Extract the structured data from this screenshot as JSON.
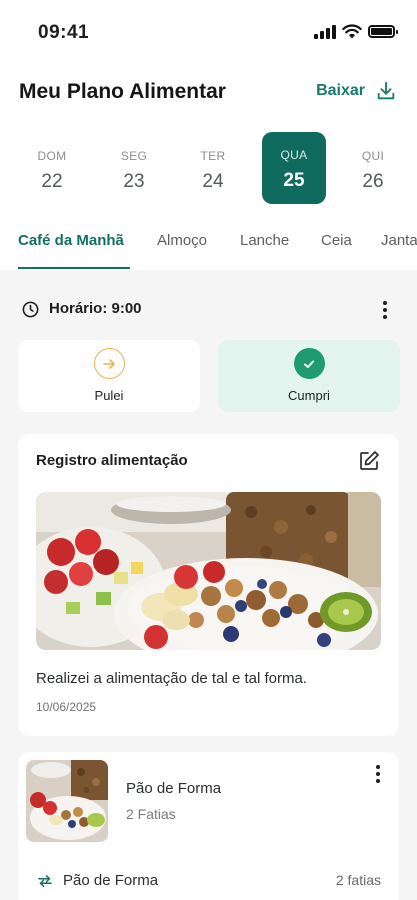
{
  "status_bar": {
    "time": "09:41"
  },
  "header": {
    "title": "Meu Plano Alimentar",
    "download_label": "Baixar"
  },
  "days": [
    {
      "name": "DOM",
      "date": "22",
      "selected": false
    },
    {
      "name": "SEG",
      "date": "23",
      "selected": false
    },
    {
      "name": "TER",
      "date": "24",
      "selected": false
    },
    {
      "name": "QUA",
      "date": "25",
      "selected": true
    },
    {
      "name": "QUI",
      "date": "26",
      "selected": false
    }
  ],
  "tabs": [
    {
      "label": "Café da Manhã",
      "active": true
    },
    {
      "label": "Almoço",
      "active": false
    },
    {
      "label": "Lanche",
      "active": false
    },
    {
      "label": "Ceia",
      "active": false
    },
    {
      "label": "Janta",
      "active": false
    }
  ],
  "meal": {
    "time_label": "Horário: 9:00",
    "skip_label": "Pulei",
    "done_label": "Cumpri"
  },
  "log_card": {
    "title": "Registro alimentação",
    "text": "Realizei a alimentação de tal e tal forma.",
    "date": "10/06/2025"
  },
  "food_card": {
    "name": "Pão de Forma",
    "quantity": "2 Fatias",
    "swap_label": "Pão de Forma",
    "swap_quantity": "2 fatias"
  },
  "colors": {
    "accent": "#0e6b5e",
    "accent_text": "#167a6c",
    "success": "#1f9b72",
    "success_bg": "#e3f4ee",
    "warning": "#f0b24a"
  },
  "icons": {
    "download": "download-icon",
    "clock": "clock-icon",
    "skip": "arrow-right-icon",
    "done": "check-icon",
    "edit": "edit-icon",
    "swap": "swap-icon",
    "menu": "kebab-icon"
  }
}
